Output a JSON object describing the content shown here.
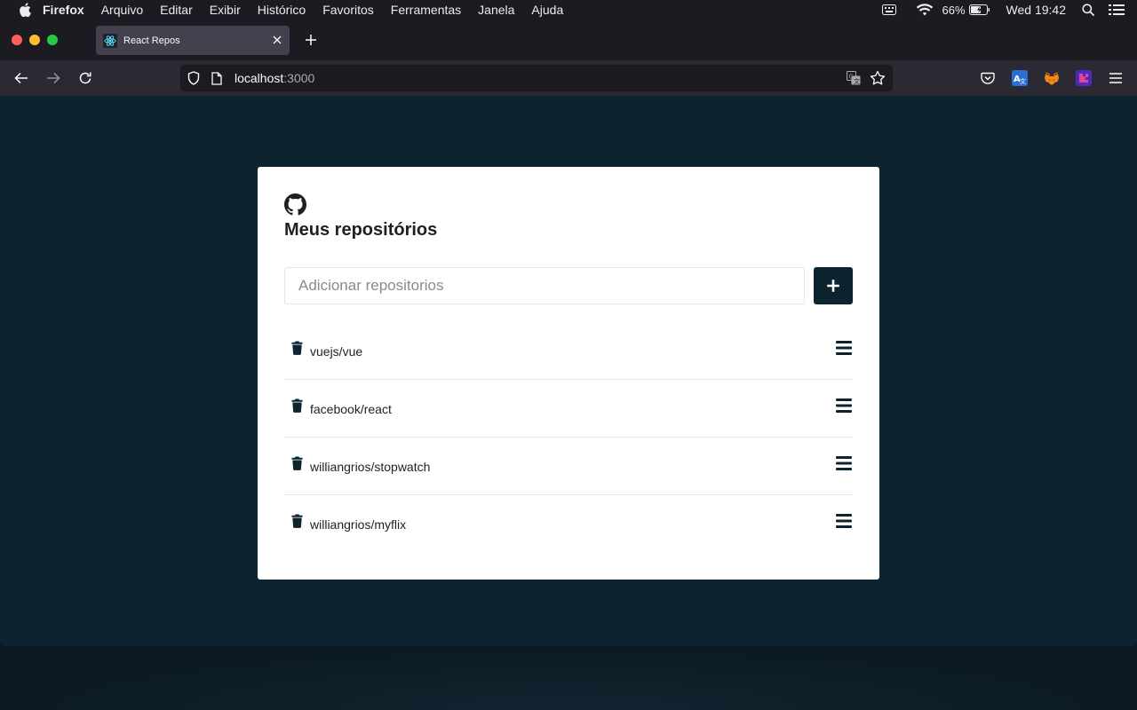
{
  "menubar": {
    "app_name": "Firefox",
    "items": [
      "Arquivo",
      "Editar",
      "Exibir",
      "Histórico",
      "Favoritos",
      "Ferramentas",
      "Janela",
      "Ajuda"
    ],
    "battery": "66%",
    "clock": "Wed 19:42"
  },
  "browser": {
    "tab_title": "React Repos",
    "url_host": "localhost",
    "url_port": ":3000"
  },
  "page": {
    "title": "Meus repositórios",
    "input_placeholder": "Adicionar repositorios",
    "input_value": "",
    "repos": [
      {
        "name": "vuejs/vue"
      },
      {
        "name": "facebook/react"
      },
      {
        "name": "williangrios/stopwatch"
      },
      {
        "name": "williangrios/myflix"
      }
    ]
  },
  "colors": {
    "background": "#0d2430",
    "card": "#ffffff",
    "accent": "#0d2430",
    "text": "#1f2023"
  },
  "icons": {
    "logo": "github-icon",
    "add": "plus-icon",
    "delete": "trash-icon",
    "drag": "bars-icon"
  }
}
